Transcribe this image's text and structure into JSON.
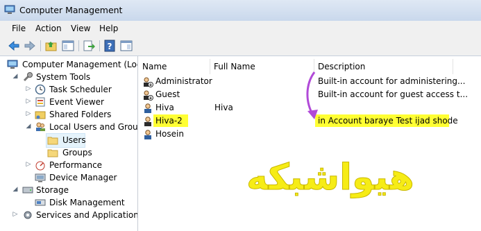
{
  "window": {
    "title": "Computer Management"
  },
  "menu": [
    "File",
    "Action",
    "View",
    "Help"
  ],
  "tree": {
    "root": "Computer Management (Local",
    "system_tools": "System Tools",
    "task_scheduler": "Task Scheduler",
    "event_viewer": "Event Viewer",
    "shared_folders": "Shared Folders",
    "local_users_groups": "Local Users and Groups",
    "users": "Users",
    "groups": "Groups",
    "performance": "Performance",
    "device_manager": "Device Manager",
    "storage": "Storage",
    "disk_management": "Disk Management",
    "services_apps": "Services and Applications"
  },
  "columns": {
    "name": "Name",
    "full_name": "Full Name",
    "description": "Description"
  },
  "users": [
    {
      "name": "Administrator",
      "full_name": "",
      "description": "Built-in account for administering..."
    },
    {
      "name": "Guest",
      "full_name": "",
      "description": "Built-in account for guest access t..."
    },
    {
      "name": "Hiva",
      "full_name": "Hiva",
      "description": ""
    },
    {
      "name": "Hiva-2",
      "full_name": "",
      "description": "in Account baraye Test ijad shode"
    },
    {
      "name": "Hosein",
      "full_name": "",
      "description": ""
    }
  ],
  "watermark": "هیواشبکه",
  "colors": {
    "highlight": "#ffff33",
    "annotation_arrow": "#b14ad8",
    "watermark": "#f6ec16"
  }
}
